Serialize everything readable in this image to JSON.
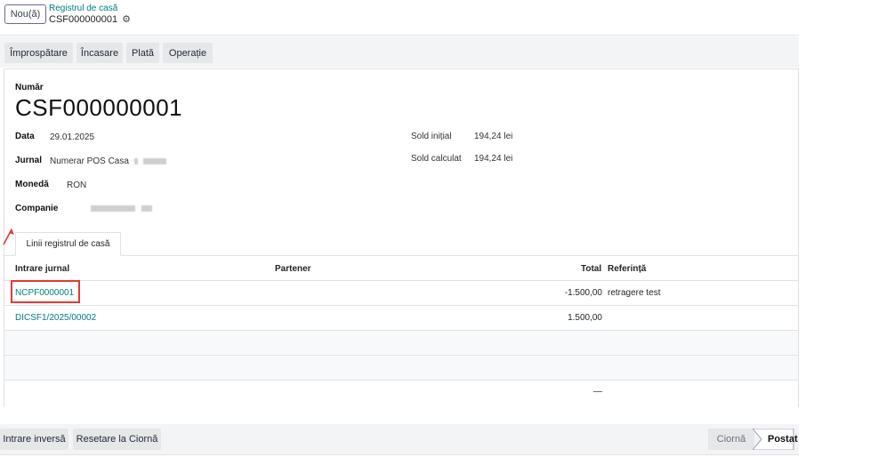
{
  "header": {
    "new_button": "Nou(ă)",
    "breadcrumb": "Registrul de casă",
    "record": "CSF000000001",
    "gear_icon": "gear-icon"
  },
  "actions": {
    "refresh": "Împrospătare",
    "income": "Încasare",
    "payment": "Plată",
    "operation": "Operație"
  },
  "form": {
    "number_label": "Număr",
    "number": "CSF000000001",
    "date_label": "Data",
    "date": "29.01.2025",
    "journal_label": "Jurnal",
    "journal": "Numerar POS Casa",
    "currency_label": "Monedă",
    "currency": "RON",
    "company_label": "Companie",
    "opening_label": "Sold inițial",
    "opening": "194,24 lei",
    "computed_label": "Sold calculat",
    "computed": "194,24 lei"
  },
  "tab": {
    "label": "Linii registrul de casă"
  },
  "table": {
    "headers": [
      "Intrare jurnal",
      "Partener",
      "Total",
      "Referință"
    ],
    "rows": [
      {
        "entry": "NCPF0000001",
        "partner": "",
        "total": "-1.500,00",
        "reference": "retragere test"
      },
      {
        "entry": "DICSF1/2025/00002",
        "partner": "",
        "total": "1.500,00",
        "reference": ""
      }
    ],
    "footer_total": "—"
  },
  "footer": {
    "reverse": "Intrare inversă",
    "reset": "Resetare la Ciornă",
    "status_draft": "Ciornă",
    "status_posted": "Postat"
  }
}
